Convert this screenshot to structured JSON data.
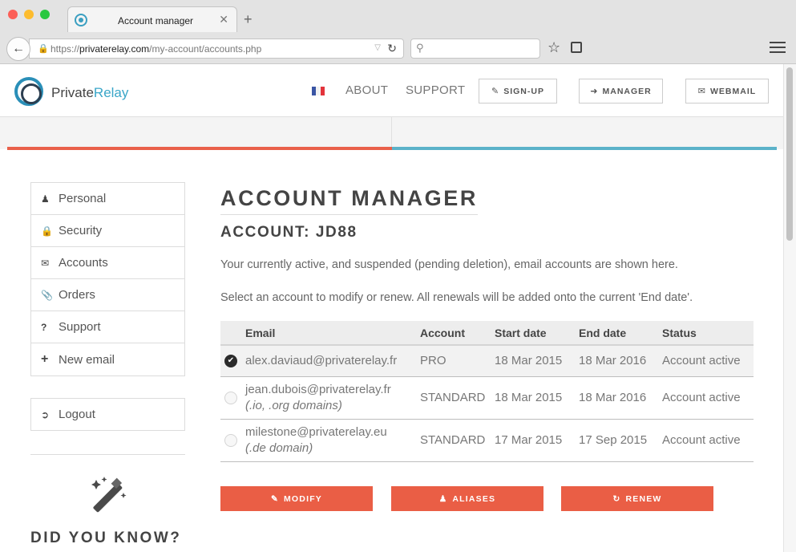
{
  "browser": {
    "tab_title": "Account manager",
    "tab_close": "✕",
    "new_tab": "+",
    "url_prefix": "https://",
    "url_host": "privaterelay.com",
    "url_path": "/my-account/accounts.php",
    "search_placeholder": ""
  },
  "header": {
    "logo_private": "Private",
    "logo_relay": "Relay",
    "flag_colors": [
      "#3a55a4",
      "#ffffff",
      "#e3333b"
    ],
    "nav": [
      "ABOUT",
      "SUPPORT"
    ],
    "buttons": {
      "signup": "SIGN-UP",
      "manager": "MANAGER",
      "webmail": "WEBMAIL"
    }
  },
  "accent": {
    "orange": "#e9604a",
    "blue": "#5bb2c9"
  },
  "sidebar": {
    "items": [
      {
        "label": "Personal",
        "icon": "user-icon"
      },
      {
        "label": "Security",
        "icon": "lock-icon"
      },
      {
        "label": "Accounts",
        "icon": "envelope-icon"
      },
      {
        "label": "Orders",
        "icon": "paperclip-icon"
      },
      {
        "label": "Support",
        "icon": "question-icon"
      },
      {
        "label": "New email",
        "icon": "plus-icon"
      }
    ],
    "logout": "Logout",
    "did_you_know": "DID YOU KNOW?"
  },
  "main": {
    "title": "ACCOUNT MANAGER",
    "subtitle": "ACCOUNT: JD88",
    "intro": "Your currently active, and suspended (pending deletion), email accounts are shown here.",
    "instruction": "Select an account to modify or renew. All renewals will be added onto the current 'End date'.",
    "columns": [
      "Email",
      "Account",
      "Start date",
      "End date",
      "Status"
    ],
    "rows": [
      {
        "selected": true,
        "email": "alex.daviaud@privaterelay.fr",
        "note": "",
        "account": "PRO",
        "start": "18 Mar 2015",
        "end": "18 Mar 2016",
        "status": "Account active"
      },
      {
        "selected": false,
        "email": "jean.dubois@privaterelay.fr",
        "note": "(.io, .org domains)",
        "account": "STANDARD",
        "start": "18 Mar 2015",
        "end": "18 Mar 2016",
        "status": "Account active"
      },
      {
        "selected": false,
        "email": "milestone@privaterelay.eu",
        "note": "(.de domain)",
        "account": "STANDARD",
        "start": "17 Mar 2015",
        "end": "17 Sep 2015",
        "status": "Account active"
      }
    ],
    "actions": {
      "modify": "MODIFY",
      "aliases": "ALIASES",
      "renew": "RENEW"
    }
  }
}
